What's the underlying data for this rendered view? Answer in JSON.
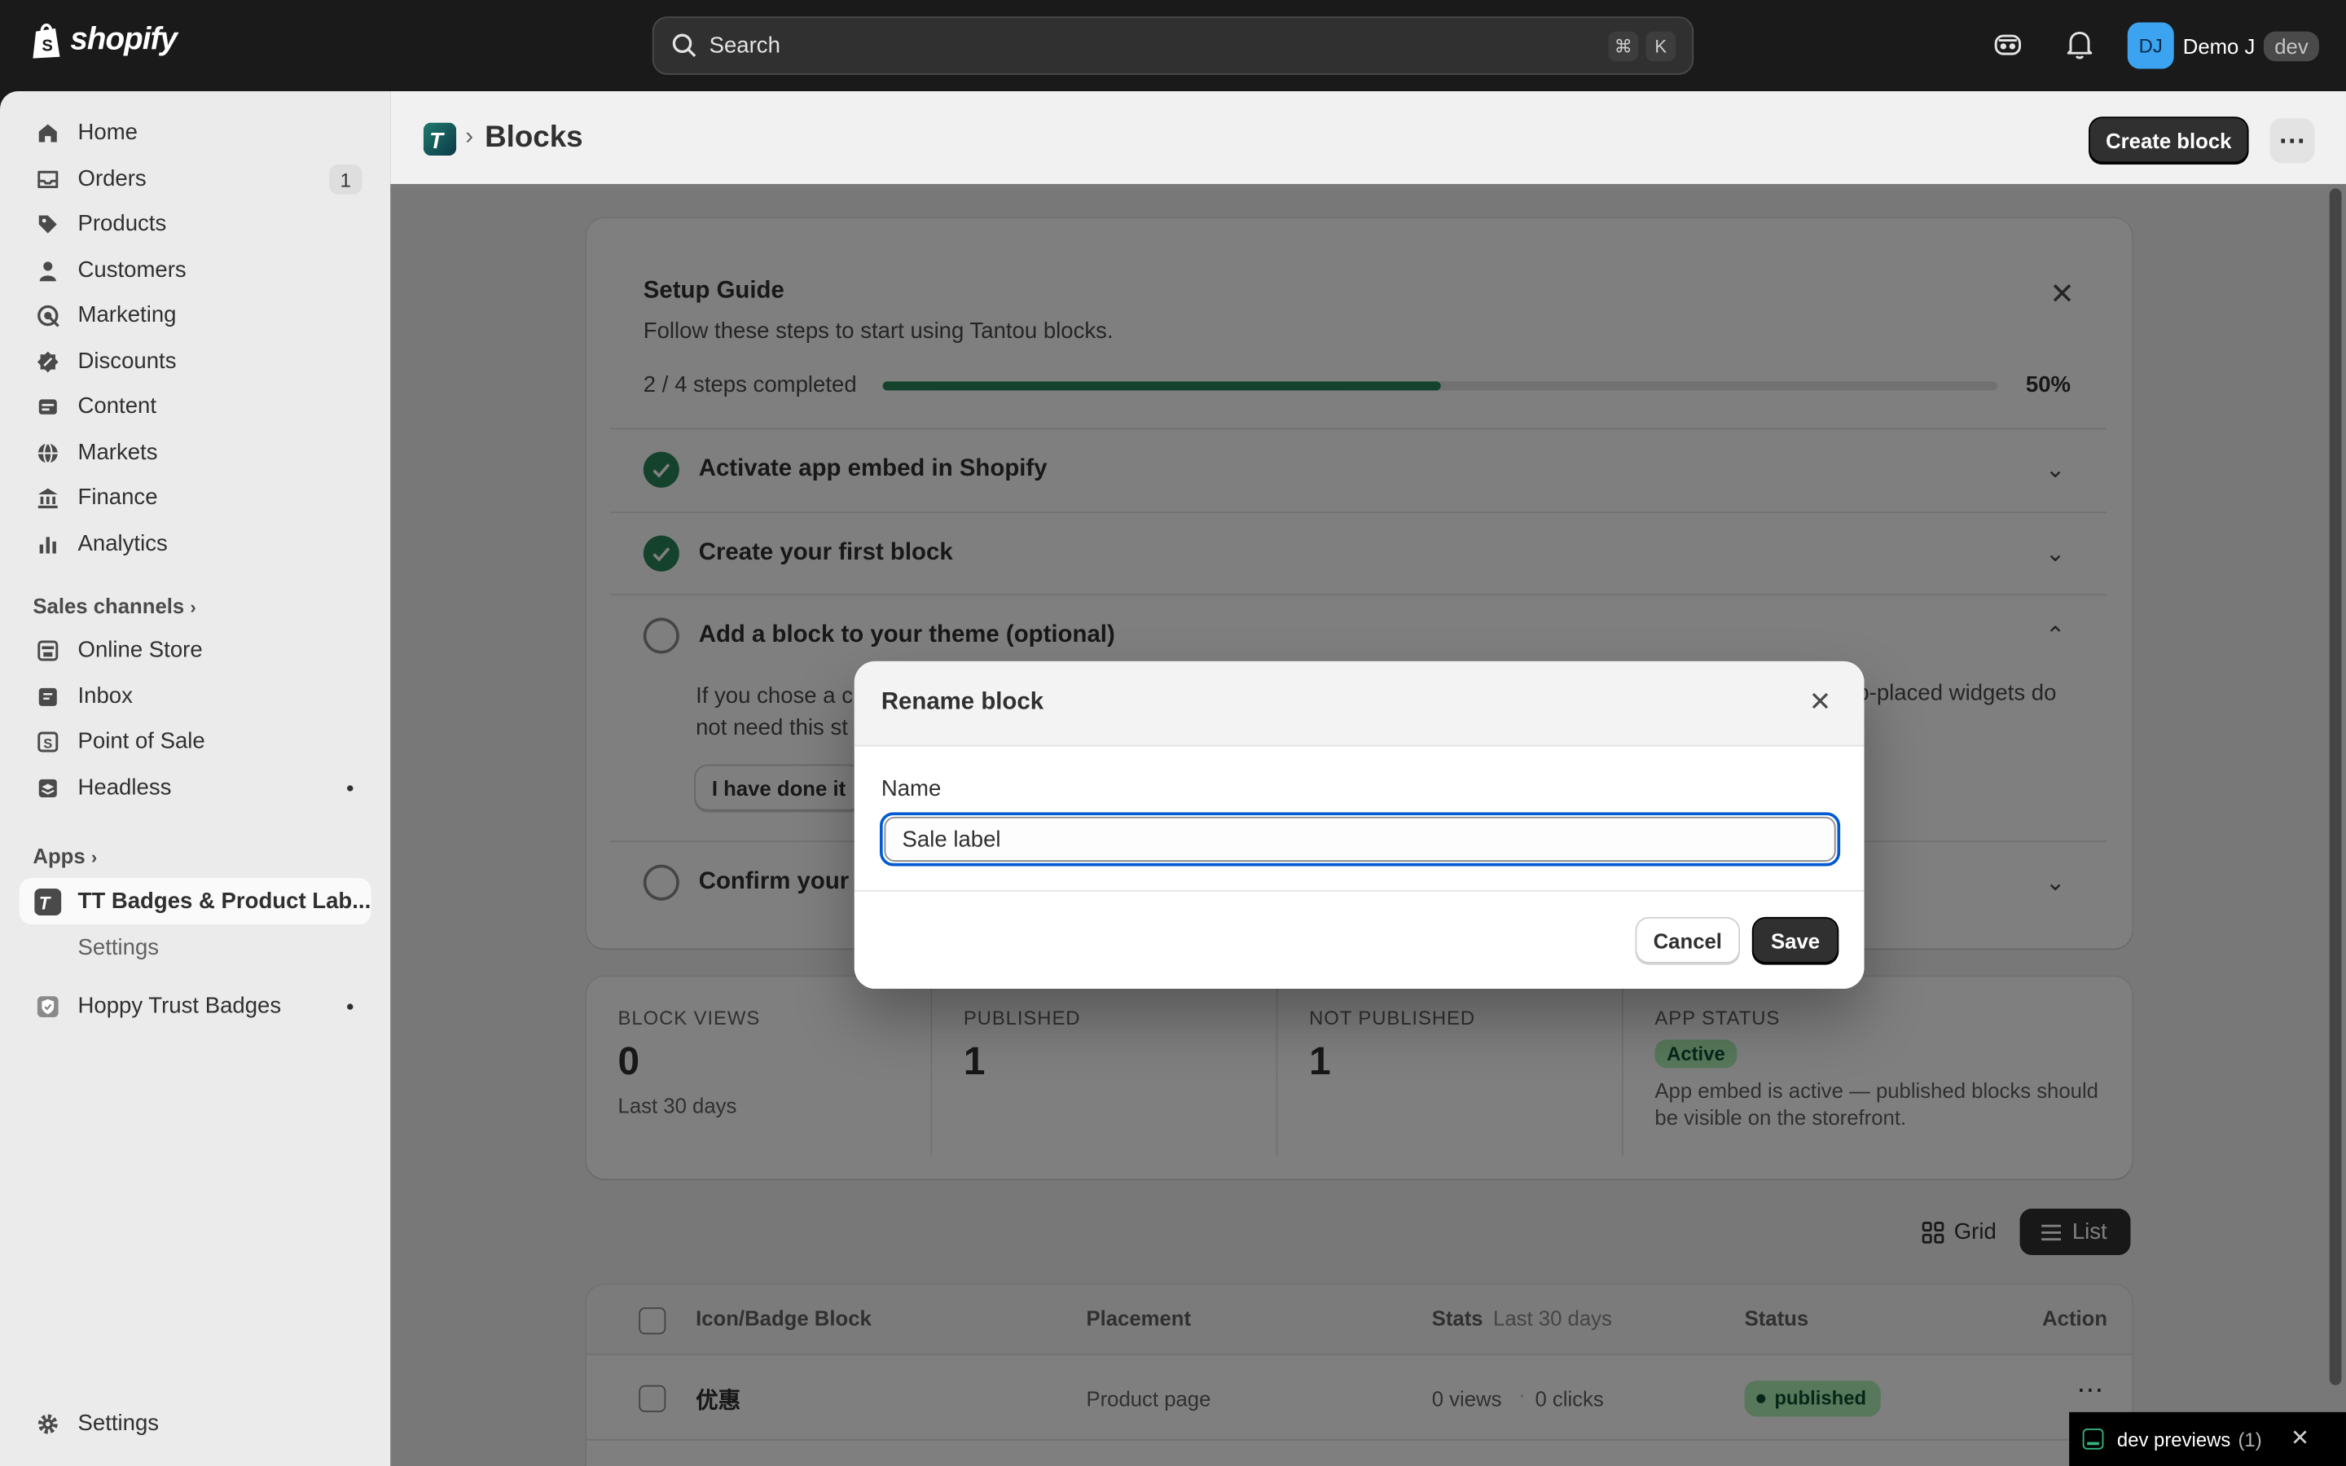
{
  "topbar": {
    "logo_text": "shopify",
    "search_placeholder": "Search",
    "shortcut_cmd": "⌘",
    "shortcut_key": "K",
    "user_initials": "DJ",
    "user_name": "Demo J",
    "user_tag": "dev"
  },
  "sidebar": {
    "items": [
      {
        "label": "Home",
        "icon": "home-icon"
      },
      {
        "label": "Orders",
        "icon": "inbox-icon",
        "badge": "1"
      },
      {
        "label": "Products",
        "icon": "tag-icon"
      },
      {
        "label": "Customers",
        "icon": "person-icon"
      },
      {
        "label": "Marketing",
        "icon": "target-icon"
      },
      {
        "label": "Discounts",
        "icon": "discount-icon"
      },
      {
        "label": "Content",
        "icon": "content-icon"
      },
      {
        "label": "Markets",
        "icon": "globe-icon"
      },
      {
        "label": "Finance",
        "icon": "bank-icon"
      },
      {
        "label": "Analytics",
        "icon": "bar-chart-icon"
      }
    ],
    "sales_channels_heading": "Sales channels",
    "channels": [
      {
        "label": "Online Store",
        "icon": "store-icon"
      },
      {
        "label": "Inbox",
        "icon": "chat-icon"
      },
      {
        "label": "Point of Sale",
        "icon": "pos-icon"
      },
      {
        "label": "Headless",
        "icon": "layers-icon"
      }
    ],
    "apps_heading": "Apps",
    "apps": [
      {
        "label": "TT Badges & Product Lab...",
        "icon": "app-tt-icon"
      },
      {
        "label": "Settings"
      },
      {
        "label": "Hoppy Trust Badges",
        "icon": "shield-check-icon"
      }
    ],
    "settings_label": "Settings"
  },
  "page": {
    "title": "Blocks",
    "create_button": "Create block",
    "more_icon": "ellipsis-icon"
  },
  "setup_guide": {
    "title": "Setup Guide",
    "subtitle": "Follow these steps to start using Tantou blocks.",
    "progress_text": "2 / 4 steps completed",
    "progress_fraction": 0.5,
    "progress_percent": "50%",
    "steps": [
      {
        "label": "Activate app embed in Shopify",
        "done": true
      },
      {
        "label": "Create your first block",
        "done": true
      },
      {
        "label": "Add a block to your theme (optional)",
        "done": false,
        "expanded": true
      },
      {
        "label": "Confirm your l",
        "done": false
      }
    ],
    "expanded_text_left": "If you chose a c",
    "expanded_text_right": "o-placed widgets do",
    "expanded_text_line2": "not need this st",
    "done_button": "I have done it"
  },
  "stats": [
    {
      "label": "BLOCK VIEWS",
      "value": "0",
      "sub": "Last 30 days"
    },
    {
      "label": "PUBLISHED",
      "value": "1"
    },
    {
      "label": "NOT PUBLISHED",
      "value": "1"
    },
    {
      "label": "APP STATUS",
      "badge": "Active",
      "desc": "App embed is active — published blocks should be visible on the storefront."
    }
  ],
  "view_toggle": {
    "grid": "Grid",
    "list": "List"
  },
  "table": {
    "headers": {
      "block": "Icon/Badge Block",
      "placement": "Placement",
      "stats": "Stats",
      "stats_sub": "Last 30 days",
      "status": "Status",
      "action": "Action"
    },
    "rows": [
      {
        "name": "优惠",
        "placement": "Product page",
        "views": "0 views",
        "clicks": "0 clicks",
        "status": "published"
      }
    ]
  },
  "modal": {
    "title": "Rename block",
    "field_label": "Name",
    "field_value": "Sale label",
    "cancel": "Cancel",
    "save": "Save"
  },
  "toast": {
    "label": "dev previews",
    "count": "(1)"
  },
  "colors": {
    "accent_green": "#29845a",
    "progress_green": "#29845a",
    "focus_blue": "#005bd3",
    "dark": "#303030"
  }
}
